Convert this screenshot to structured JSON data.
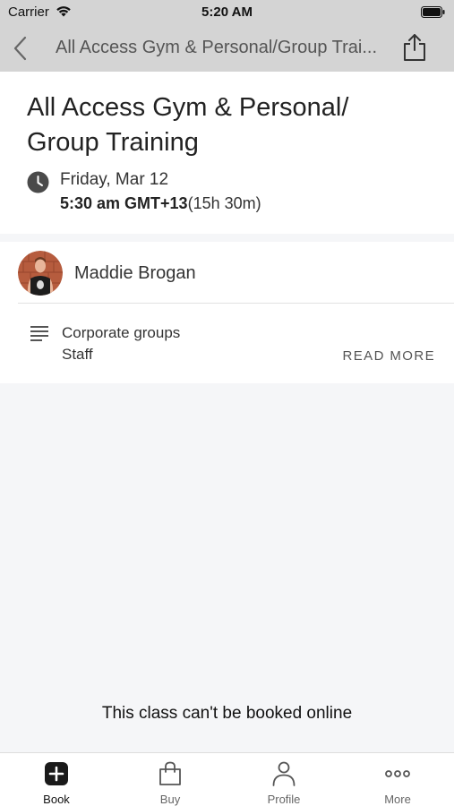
{
  "status_bar": {
    "carrier": "Carrier",
    "time": "5:20 AM"
  },
  "nav": {
    "title": "All Access Gym & Personal/Group Trai..."
  },
  "class_info": {
    "title": "All Access Gym & Personal/ Group Training",
    "date": "Friday, Mar 12",
    "time": "5:30 am GMT+13",
    "duration": "(15h 30m)"
  },
  "instructor": {
    "name": "Maddie Brogan"
  },
  "description": {
    "line1": "Corporate groups",
    "line2": "Staff",
    "read_more": "READ MORE"
  },
  "booking_note": "This class can't be booked online",
  "tabs": [
    {
      "label": "Book",
      "icon": "plus-square-icon",
      "active": true
    },
    {
      "label": "Buy",
      "icon": "shopping-bag-icon",
      "active": false
    },
    {
      "label": "Profile",
      "icon": "person-icon",
      "active": false
    },
    {
      "label": "More",
      "icon": "more-dots-icon",
      "active": false
    }
  ],
  "colors": {
    "nav_background": "#d4d4d4",
    "page_background": "#f5f6f8",
    "card_background": "#ffffff",
    "icon_dark": "#444444"
  }
}
